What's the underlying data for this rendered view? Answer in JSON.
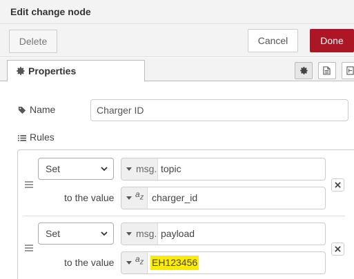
{
  "header": {
    "title": "Edit change node"
  },
  "toolbar": {
    "delete_label": "Delete",
    "cancel_label": "Cancel",
    "done_label": "Done"
  },
  "tabs": {
    "properties_label": "Properties"
  },
  "form": {
    "name_label": "Name",
    "name_value": "Charger ID",
    "rules_label": "Rules"
  },
  "rules": [
    {
      "action": "Set",
      "target_prefix": "msg.",
      "target": "topic",
      "to_label": "to the value",
      "value_type_icon": "string-az-icon",
      "value": "charger_id"
    },
    {
      "action": "Set",
      "target_prefix": "msg.",
      "target": "payload",
      "to_label": "to the value",
      "value_type_icon": "string-az-icon",
      "value": "EH123456"
    }
  ],
  "colors": {
    "done_button": "#ad1625",
    "highlight": "#ffeb00"
  }
}
